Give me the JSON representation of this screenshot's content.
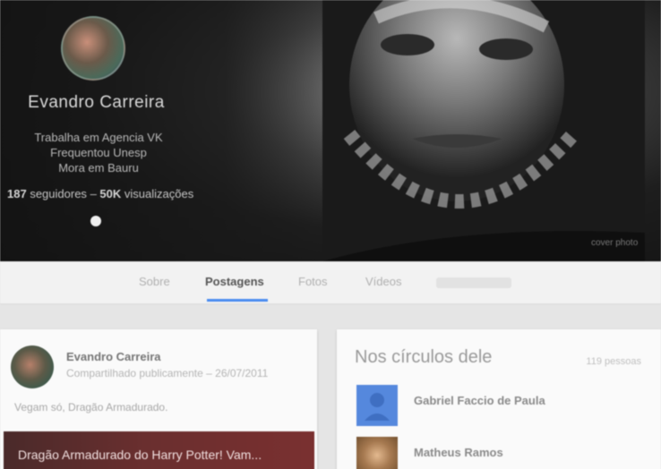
{
  "profile": {
    "name": "Evandro Carreira",
    "lines": [
      "Trabalha em Agencia VK",
      "Frequentou Unesp",
      "Mora em Bauru"
    ],
    "followers_count": "187",
    "followers_label": "seguidores",
    "separator": "–",
    "views_count": "50K",
    "views_label": "visualizações"
  },
  "cover": {
    "credit": "cover photo"
  },
  "tabs": [
    {
      "label": "Sobre",
      "active": false
    },
    {
      "label": "Postagens",
      "active": true
    },
    {
      "label": "Fotos",
      "active": false
    },
    {
      "label": "Vídeos",
      "active": false
    }
  ],
  "post": {
    "author": "Evandro Carreira",
    "visibility": "Compartilhado publicamente",
    "separator": "–",
    "date": "26/07/2011",
    "text": "Vegam só, Dragão Armadurado.",
    "media_title": "Dragão Armadurado do Harry Potter! Vam..."
  },
  "circles": {
    "title": "Nos círculos dele",
    "count": "119 pessoas",
    "people": [
      {
        "name": "Gabriel Faccio de Paula"
      },
      {
        "name": "Matheus Ramos"
      }
    ]
  },
  "colors": {
    "accent": "#4a8cf0",
    "blue_avatar": "#5588dd",
    "media_bg": "#6a2f2f"
  },
  "icons": {
    "default_avatar": "person-silhouette-icon"
  }
}
